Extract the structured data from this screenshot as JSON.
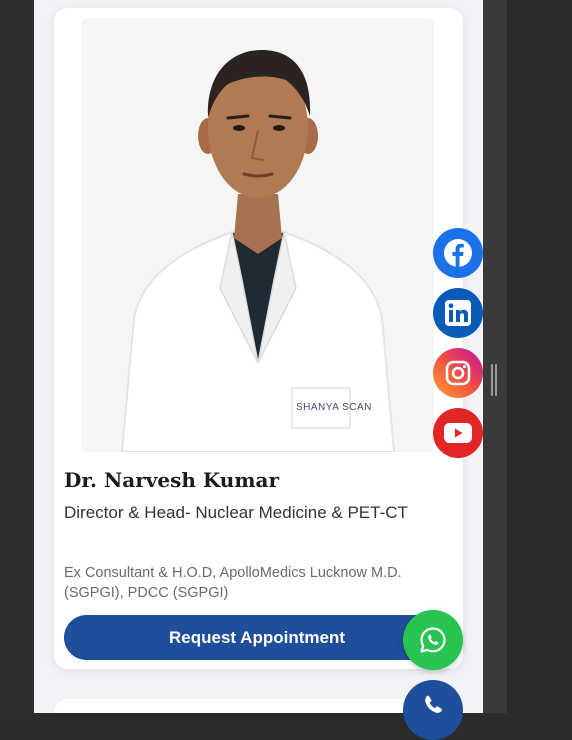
{
  "doctor": {
    "name": "Dr. Narvesh Kumar",
    "title": "Director & Head- Nuclear Medicine & PET-CT",
    "credentials": "Ex Consultant & H.O.D, ApolloMedics Lucknow M.D. (SGPGI), PDCC (SGPGI)",
    "coat_logo_text": "SHANYA SCAN",
    "appointment_label": "Request Appointment"
  },
  "social": [
    {
      "icon": "facebook-icon",
      "color": "#1b72e8"
    },
    {
      "icon": "linkedin-icon",
      "color": "#0a5bb8"
    },
    {
      "icon": "instagram-icon",
      "color": "#e4405f"
    },
    {
      "icon": "youtube-icon",
      "color": "#e12626"
    }
  ],
  "floating": {
    "whatsapp": {
      "icon": "whatsapp-icon",
      "color": "#28c452"
    },
    "call": {
      "icon": "phone-icon",
      "color": "#1f4e9a"
    }
  },
  "colors": {
    "primary": "#1f4e9a",
    "page_bg": "#f1f3f6"
  }
}
